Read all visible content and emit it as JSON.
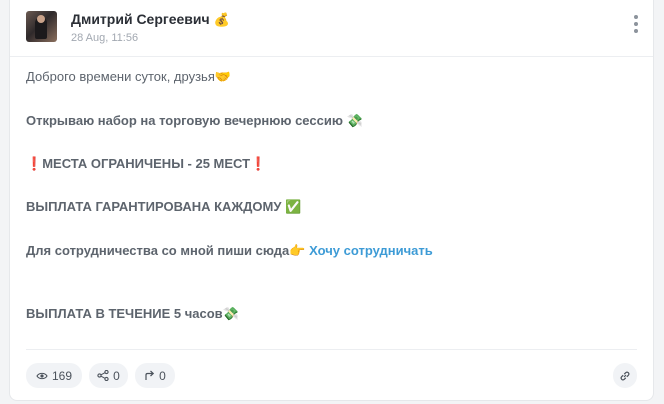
{
  "post": {
    "author": "Дмитрий Сергеевич",
    "author_emoji": "💰",
    "date": "28 Aug, 11:56",
    "lines": {
      "greeting": "Доброго времени суток, друзья",
      "greeting_emoji": "🤝",
      "announce": "Открываю набор на торговую вечернюю сессию",
      "announce_emoji": "💸",
      "limited_mark_left": "❗",
      "limited": "МЕСТА ОГРАНИЧЕНЫ - 25 МЕСТ",
      "limited_mark_right": "❗",
      "guarantee": "ВЫПЛАТА ГАРАНТИРОВАНА КАЖДОМУ",
      "guarantee_emoji": "✅",
      "contact": "Для сотрудничества со мной пиши сюда",
      "contact_emoji": "👉",
      "contact_link": "Хочу сотрудничать",
      "payout": "ВЫПЛАТА В ТЕЧЕНИЕ 5 часов",
      "payout_emoji": "💸"
    }
  },
  "stats": {
    "views": "169",
    "shares": "0",
    "forwards": "0"
  },
  "icons": {
    "author_badge": "money-bag-icon",
    "menu": "more-vertical-icon",
    "views": "eye-icon",
    "shares": "share-icon",
    "forwards": "forward-icon",
    "link": "link-icon"
  },
  "colors": {
    "link": "#3d9bd6",
    "text": "#5d646d",
    "author": "#2b2f36",
    "muted": "#a2a8b1"
  }
}
